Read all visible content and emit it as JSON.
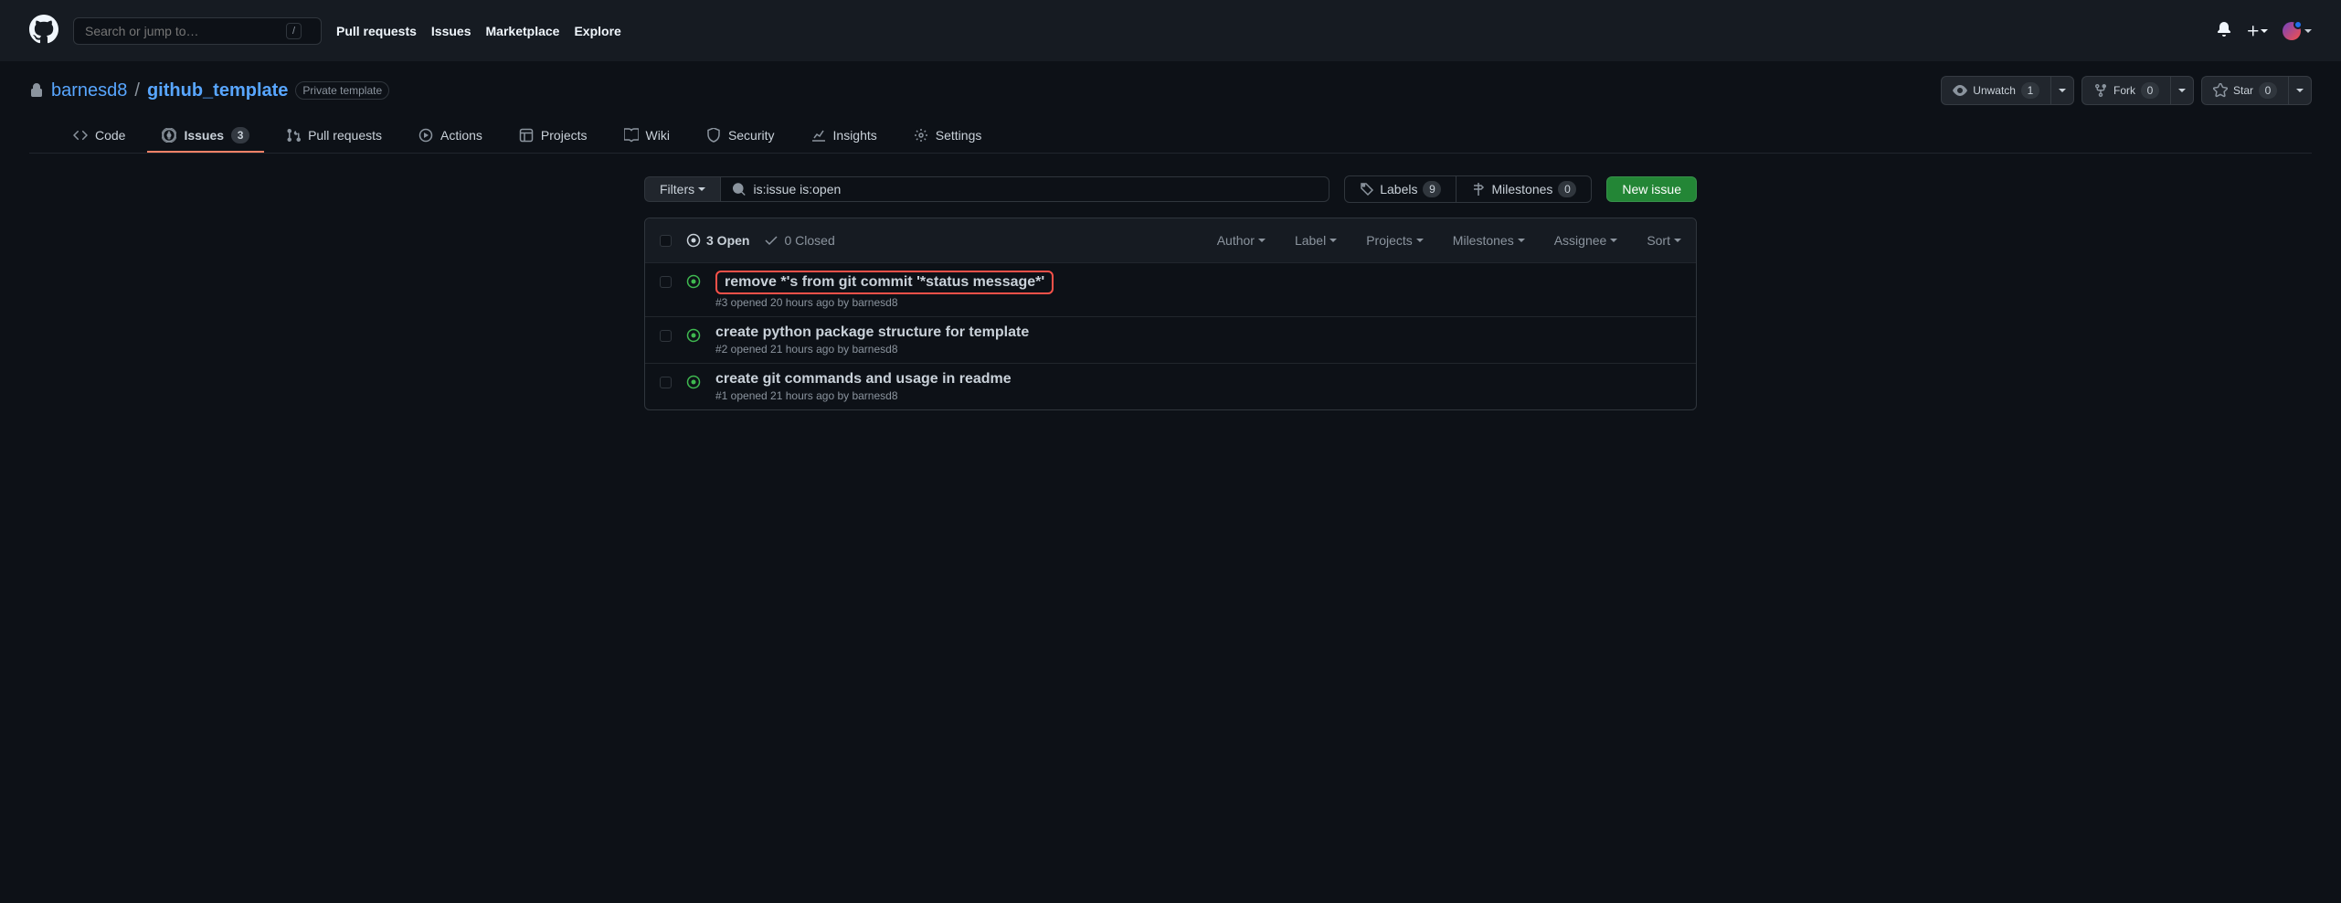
{
  "globalHeader": {
    "searchPlaceholder": "Search or jump to…",
    "slashKey": "/",
    "nav": {
      "pullRequests": "Pull requests",
      "issues": "Issues",
      "marketplace": "Marketplace",
      "explore": "Explore"
    }
  },
  "repo": {
    "owner": "barnesd8",
    "sep": "/",
    "name": "github_template",
    "visibility": "Private template",
    "watch": {
      "label": "Unwatch",
      "count": "1"
    },
    "fork": {
      "label": "Fork",
      "count": "0"
    },
    "star": {
      "label": "Star",
      "count": "0"
    }
  },
  "repoNav": {
    "code": "Code",
    "issues": {
      "label": "Issues",
      "count": "3"
    },
    "pullRequests": "Pull requests",
    "actions": "Actions",
    "projects": "Projects",
    "wiki": "Wiki",
    "security": "Security",
    "insights": "Insights",
    "settings": "Settings"
  },
  "filters": {
    "filtersLabel": "Filters",
    "query": "is:issue is:open",
    "labels": {
      "label": "Labels",
      "count": "9"
    },
    "milestones": {
      "label": "Milestones",
      "count": "0"
    },
    "newIssue": "New issue"
  },
  "issuesHeader": {
    "open": "3 Open",
    "closed": "0 Closed",
    "filters": {
      "author": "Author",
      "label": "Label",
      "projects": "Projects",
      "milestones": "Milestones",
      "assignee": "Assignee",
      "sort": "Sort"
    }
  },
  "issues": [
    {
      "title": "remove *'s from git commit '*status message*'",
      "meta": "#3 opened 20 hours ago by barnesd8",
      "highlighted": true
    },
    {
      "title": "create python package structure for template",
      "meta": "#2 opened 21 hours ago by barnesd8",
      "highlighted": false
    },
    {
      "title": "create git commands and usage in readme",
      "meta": "#1 opened 21 hours ago by barnesd8",
      "highlighted": false
    }
  ]
}
